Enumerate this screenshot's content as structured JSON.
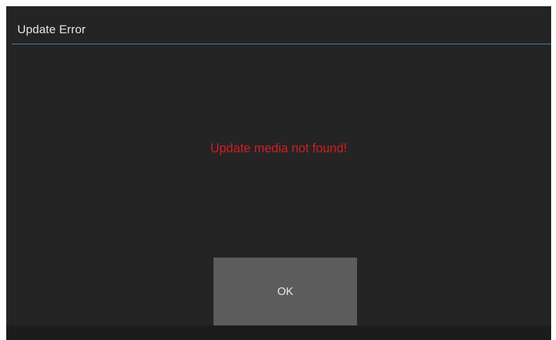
{
  "dialog": {
    "title": "Update Error",
    "message": "Update media not found!",
    "ok_label": "OK"
  },
  "colors": {
    "background": "#242424",
    "divider": "#2f8fb3",
    "message": "#d31c23",
    "button": "#5c5c5c",
    "text": "#e6e6e6"
  }
}
